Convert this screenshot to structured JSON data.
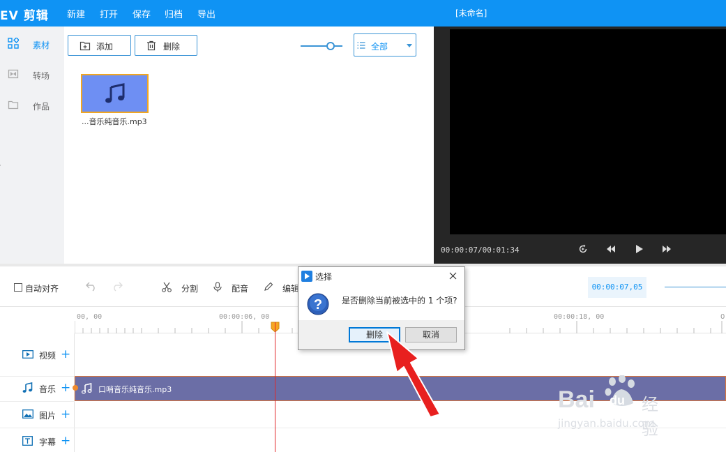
{
  "app": {
    "title": "EV 剪辑",
    "document_name": "[未命名]"
  },
  "menu": [
    "新建",
    "打开",
    "保存",
    "归档",
    "导出"
  ],
  "sidebar": {
    "items": [
      {
        "label": "素材",
        "icon": "grid-icon",
        "active": true
      },
      {
        "label": "转场",
        "icon": "transition-icon",
        "active": false
      },
      {
        "label": "作品",
        "icon": "folder-icon",
        "active": false
      }
    ],
    "edge_text": "ኔ"
  },
  "media": {
    "add_label": "添加",
    "delete_label": "删除",
    "filter_value": "全部",
    "items": [
      {
        "name": "...音乐纯音乐.mp3",
        "icon": "music-note-icon"
      }
    ]
  },
  "preview": {
    "time": "00:00:07/00:01:34"
  },
  "toolbar": {
    "auto_align": "自动对齐",
    "split": "分割",
    "dub": "配音",
    "edit": "编辑",
    "current_time": "00:00:07,05"
  },
  "ruler": {
    "ticks": [
      "00, 00",
      "00:00:06, 00",
      "00:00:18, 00"
    ]
  },
  "tracks": [
    {
      "label": "视频",
      "icon": "video-icon"
    },
    {
      "label": "音乐",
      "icon": "music-icon"
    },
    {
      "label": "图片",
      "icon": "image-icon"
    },
    {
      "label": "字幕",
      "icon": "text-icon"
    }
  ],
  "music_clip": {
    "name": "口哨音乐纯音乐.mp3"
  },
  "dialog": {
    "title": "选择",
    "message": "是否删除当前被选中的 1 个项?",
    "confirm_label": "删除",
    "cancel_label": "取消"
  },
  "watermark": {
    "brand": "Bai",
    "brand2": "du",
    "cn": "经验",
    "url": "jingyan.baidu.com"
  },
  "colors": {
    "accent": "#0f93f4",
    "clip": "#6b6ea6",
    "playhead": "#e0272a",
    "thumb": "#6e8ff3",
    "arrow": "#e8201f"
  }
}
